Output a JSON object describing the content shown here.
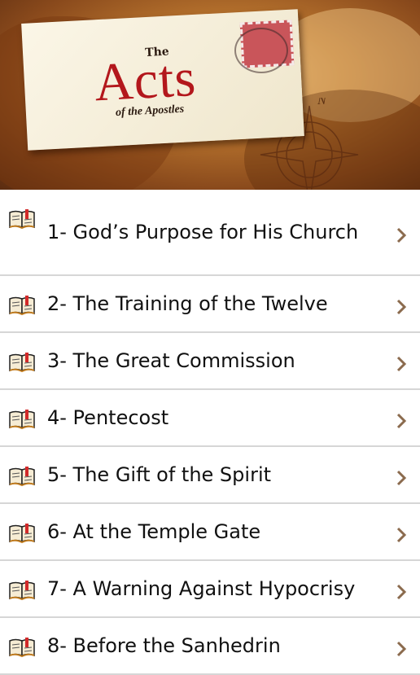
{
  "header": {
    "title_small": "The",
    "title_main": "Acts",
    "title_sub": "of the Apostles"
  },
  "chapters": [
    {
      "label": "1- God’s Purpose for His Church"
    },
    {
      "label": "2- The Training of the Twelve"
    },
    {
      "label": "3- The Great Commission"
    },
    {
      "label": "4- Pentecost"
    },
    {
      "label": "5- The Gift of the Spirit"
    },
    {
      "label": "6- At the Temple Gate"
    },
    {
      "label": "7- A Warning Against Hypocrisy"
    },
    {
      "label": "8- Before the Sanhedrin"
    }
  ],
  "icons": {
    "row_icon": "open-book-icon",
    "row_chevron": "chevron-right-icon"
  },
  "colors": {
    "title_red": "#b3171c",
    "chevron": "#8b6b4e",
    "divider": "#d6d6d6"
  }
}
